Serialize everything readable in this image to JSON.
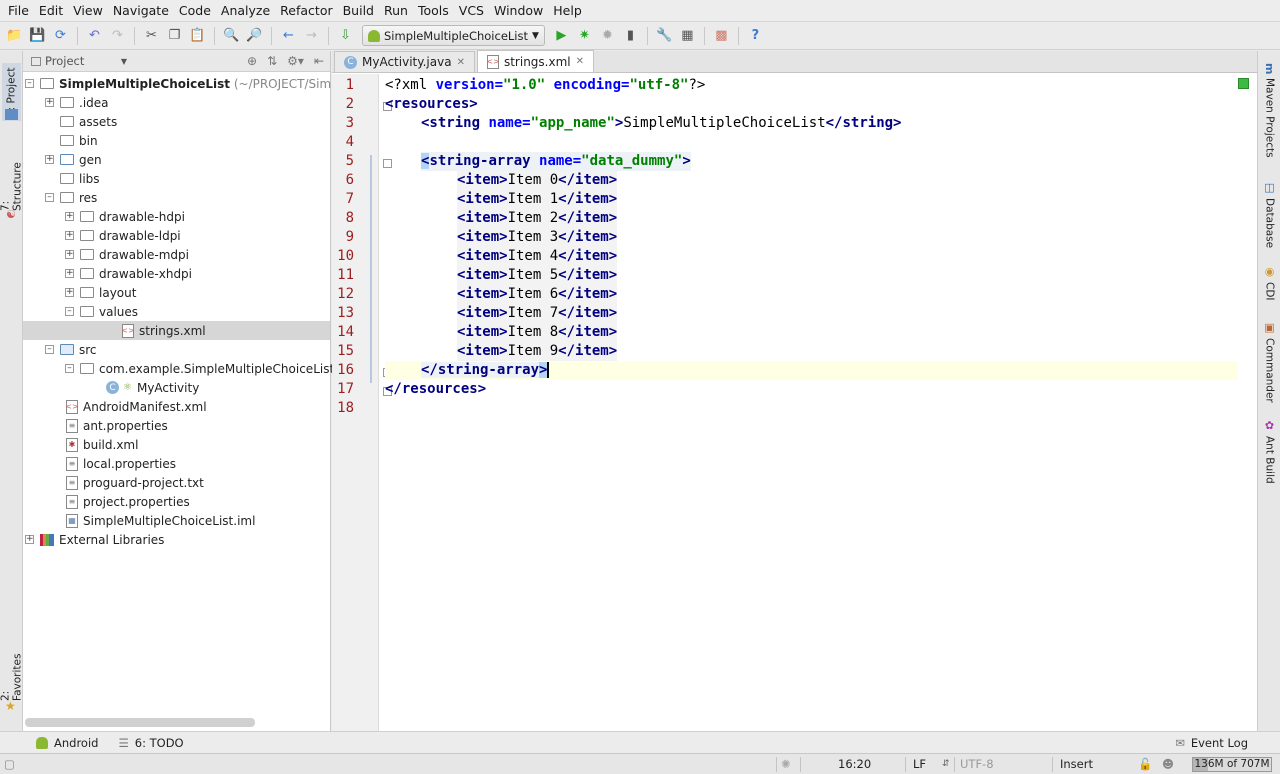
{
  "menu": [
    "File",
    "Edit",
    "View",
    "Navigate",
    "Code",
    "Analyze",
    "Refactor",
    "Build",
    "Run",
    "Tools",
    "VCS",
    "Window",
    "Help"
  ],
  "toolbar": {
    "run_config": "SimpleMultipleChoiceList",
    "icons": [
      "open-icon",
      "save-icon",
      "sync-icon",
      "undo-icon",
      "redo-icon",
      "cut-icon",
      "copy-icon",
      "paste-icon",
      "find-icon",
      "replace-icon",
      "back-icon",
      "forward-icon",
      "make-icon",
      "run-icon",
      "debug-icon",
      "attach-icon",
      "device-icon",
      "settings-icon",
      "structure-icon",
      "sdk-icon",
      "help-icon"
    ]
  },
  "left_tabs": {
    "project": "1: Project",
    "structure": "7: Structure",
    "favorites": "2: Favorites"
  },
  "right_tabs": {
    "maven": "Maven Projects",
    "database": "Database",
    "cdi": "CDI",
    "commander": "Commander",
    "ant": "Ant Build"
  },
  "project_panel": {
    "selector": "Project",
    "root_name": "SimpleMultipleChoiceList",
    "root_path": "(~/PROJECT/SimpleM",
    "tree": {
      "idea": ".idea",
      "assets": "assets",
      "bin": "bin",
      "gen": "gen",
      "libs": "libs",
      "res": "res",
      "drawable_hdpi": "drawable-hdpi",
      "drawable_ldpi": "drawable-ldpi",
      "drawable_mdpi": "drawable-mdpi",
      "drawable_xhdpi": "drawable-xhdpi",
      "layout": "layout",
      "values": "values",
      "strings_xml": "strings.xml",
      "src": "src",
      "package": "com.example.SimpleMultipleChoiceList",
      "my_activity": "MyActivity",
      "manifest": "AndroidManifest.xml",
      "ant_properties": "ant.properties",
      "build_xml": "build.xml",
      "local_properties": "local.properties",
      "proguard": "proguard-project.txt",
      "project_properties": "project.properties",
      "iml": "SimpleMultipleChoiceList.iml",
      "external_libraries": "External Libraries"
    }
  },
  "editor": {
    "tabs": [
      {
        "label": "MyActivity.java",
        "icon": "C"
      },
      {
        "label": "strings.xml",
        "icon": "xml"
      }
    ],
    "line_numbers": [
      "1",
      "2",
      "3",
      "4",
      "5",
      "6",
      "7",
      "8",
      "9",
      "10",
      "11",
      "12",
      "13",
      "14",
      "15",
      "16",
      "17",
      "18"
    ],
    "code": {
      "l1_a": "<?xml ",
      "l1_attr1": "version=",
      "l1_val1": "\"1.0\"",
      "l1_sp": " ",
      "l1_attr2": "encoding=",
      "l1_val2": "\"utf-8\"",
      "l1_end": "?>",
      "l2_tag": "<resources>",
      "l3_open": "<string ",
      "l3_attr": "name=",
      "l3_val": "\"app_name\"",
      "l3_gt": ">",
      "l3_text": "SimpleMultipleChoiceList",
      "l3_close": "</string>",
      "l5_lt": "<",
      "l5_open": "string-array ",
      "l5_attr": "name=",
      "l5_val": "\"data_dummy\"",
      "l5_gt": ">",
      "items": [
        "Item 0",
        "Item 1",
        "Item 2",
        "Item 3",
        "Item 4",
        "Item 5",
        "Item 6",
        "Item 7",
        "Item 8",
        "Item 9"
      ],
      "item_open": "<item>",
      "item_close": "</item>",
      "l16_close": "</string-array",
      "l16_gt": ">",
      "l17_close": "</resources>"
    }
  },
  "bottom_tabs": {
    "android": "Android",
    "todo": "6: TODO",
    "event_log": "Event Log"
  },
  "status": {
    "position": "16:20",
    "line_sep": "LF",
    "encoding": "UTF-8",
    "mode": "Insert",
    "memory": "136M of 707M"
  }
}
